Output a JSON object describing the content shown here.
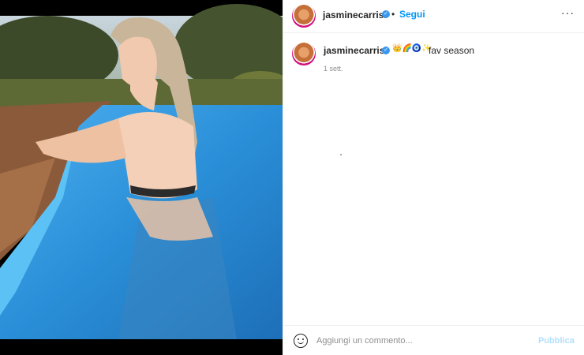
{
  "post": {
    "username": "jasminecarrisi",
    "verified_icon": "verified-badge-icon",
    "follow_label": "Segui",
    "separator": "•",
    "more_label": "···"
  },
  "caption": {
    "username": "jasminecarrisi",
    "emojis": "👑🌈🧿✨",
    "text": "fav season",
    "timestamp": "1 sett."
  },
  "comment": {
    "placeholder": "Aggiungi un commento...",
    "post_label": "Pubblica",
    "emoji_icon": "smiley-icon"
  },
  "photo": {
    "subject": "woman in bikini standing in a swimming pool",
    "sky_color": "#c9d6de",
    "foliage_color": "#3d4a2a",
    "pool_color": "#2a8fd8",
    "deck_color": "#8a5a3a"
  }
}
